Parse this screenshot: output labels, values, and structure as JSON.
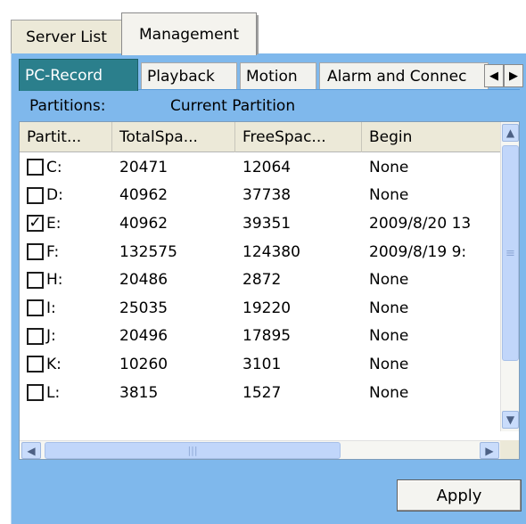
{
  "top_tabs": {
    "server_list": "Server List",
    "management": "Management"
  },
  "sub_tabs": [
    {
      "label": "PC-Record",
      "active": true
    },
    {
      "label": "Playback",
      "active": false
    },
    {
      "label": "Motion",
      "active": false
    },
    {
      "label": "Alarm and Connec",
      "active": false
    }
  ],
  "tab_scroll": {
    "left": "◀",
    "right": "▶"
  },
  "partitions": {
    "label": "Partitions:",
    "current": "Current Partition"
  },
  "grid": {
    "columns": [
      "Partit...",
      "TotalSpa...",
      "FreeSpac...",
      "Begin"
    ],
    "rows": [
      {
        "checked": false,
        "drive": "C:",
        "total": "20471",
        "free": "12064",
        "begin": "None"
      },
      {
        "checked": false,
        "drive": "D:",
        "total": "40962",
        "free": "37738",
        "begin": "None"
      },
      {
        "checked": true,
        "drive": "E:",
        "total": "40962",
        "free": "39351",
        "begin": "2009/8/20 13"
      },
      {
        "checked": false,
        "drive": "F:",
        "total": "132575",
        "free": "124380",
        "begin": "2009/8/19 9:"
      },
      {
        "checked": false,
        "drive": "H:",
        "total": "20486",
        "free": "2872",
        "begin": "None"
      },
      {
        "checked": false,
        "drive": "I:",
        "total": "25035",
        "free": "19220",
        "begin": "None"
      },
      {
        "checked": false,
        "drive": "J:",
        "total": "20496",
        "free": "17895",
        "begin": "None"
      },
      {
        "checked": false,
        "drive": "K:",
        "total": "10260",
        "free": "3101",
        "begin": "None"
      },
      {
        "checked": false,
        "drive": "L:",
        "total": "3815",
        "free": "1527",
        "begin": "None"
      }
    ]
  },
  "apply_label": "Apply",
  "colors": {
    "panel_blue": "#7fb8ec",
    "active_tab": "#2b7f8c"
  }
}
